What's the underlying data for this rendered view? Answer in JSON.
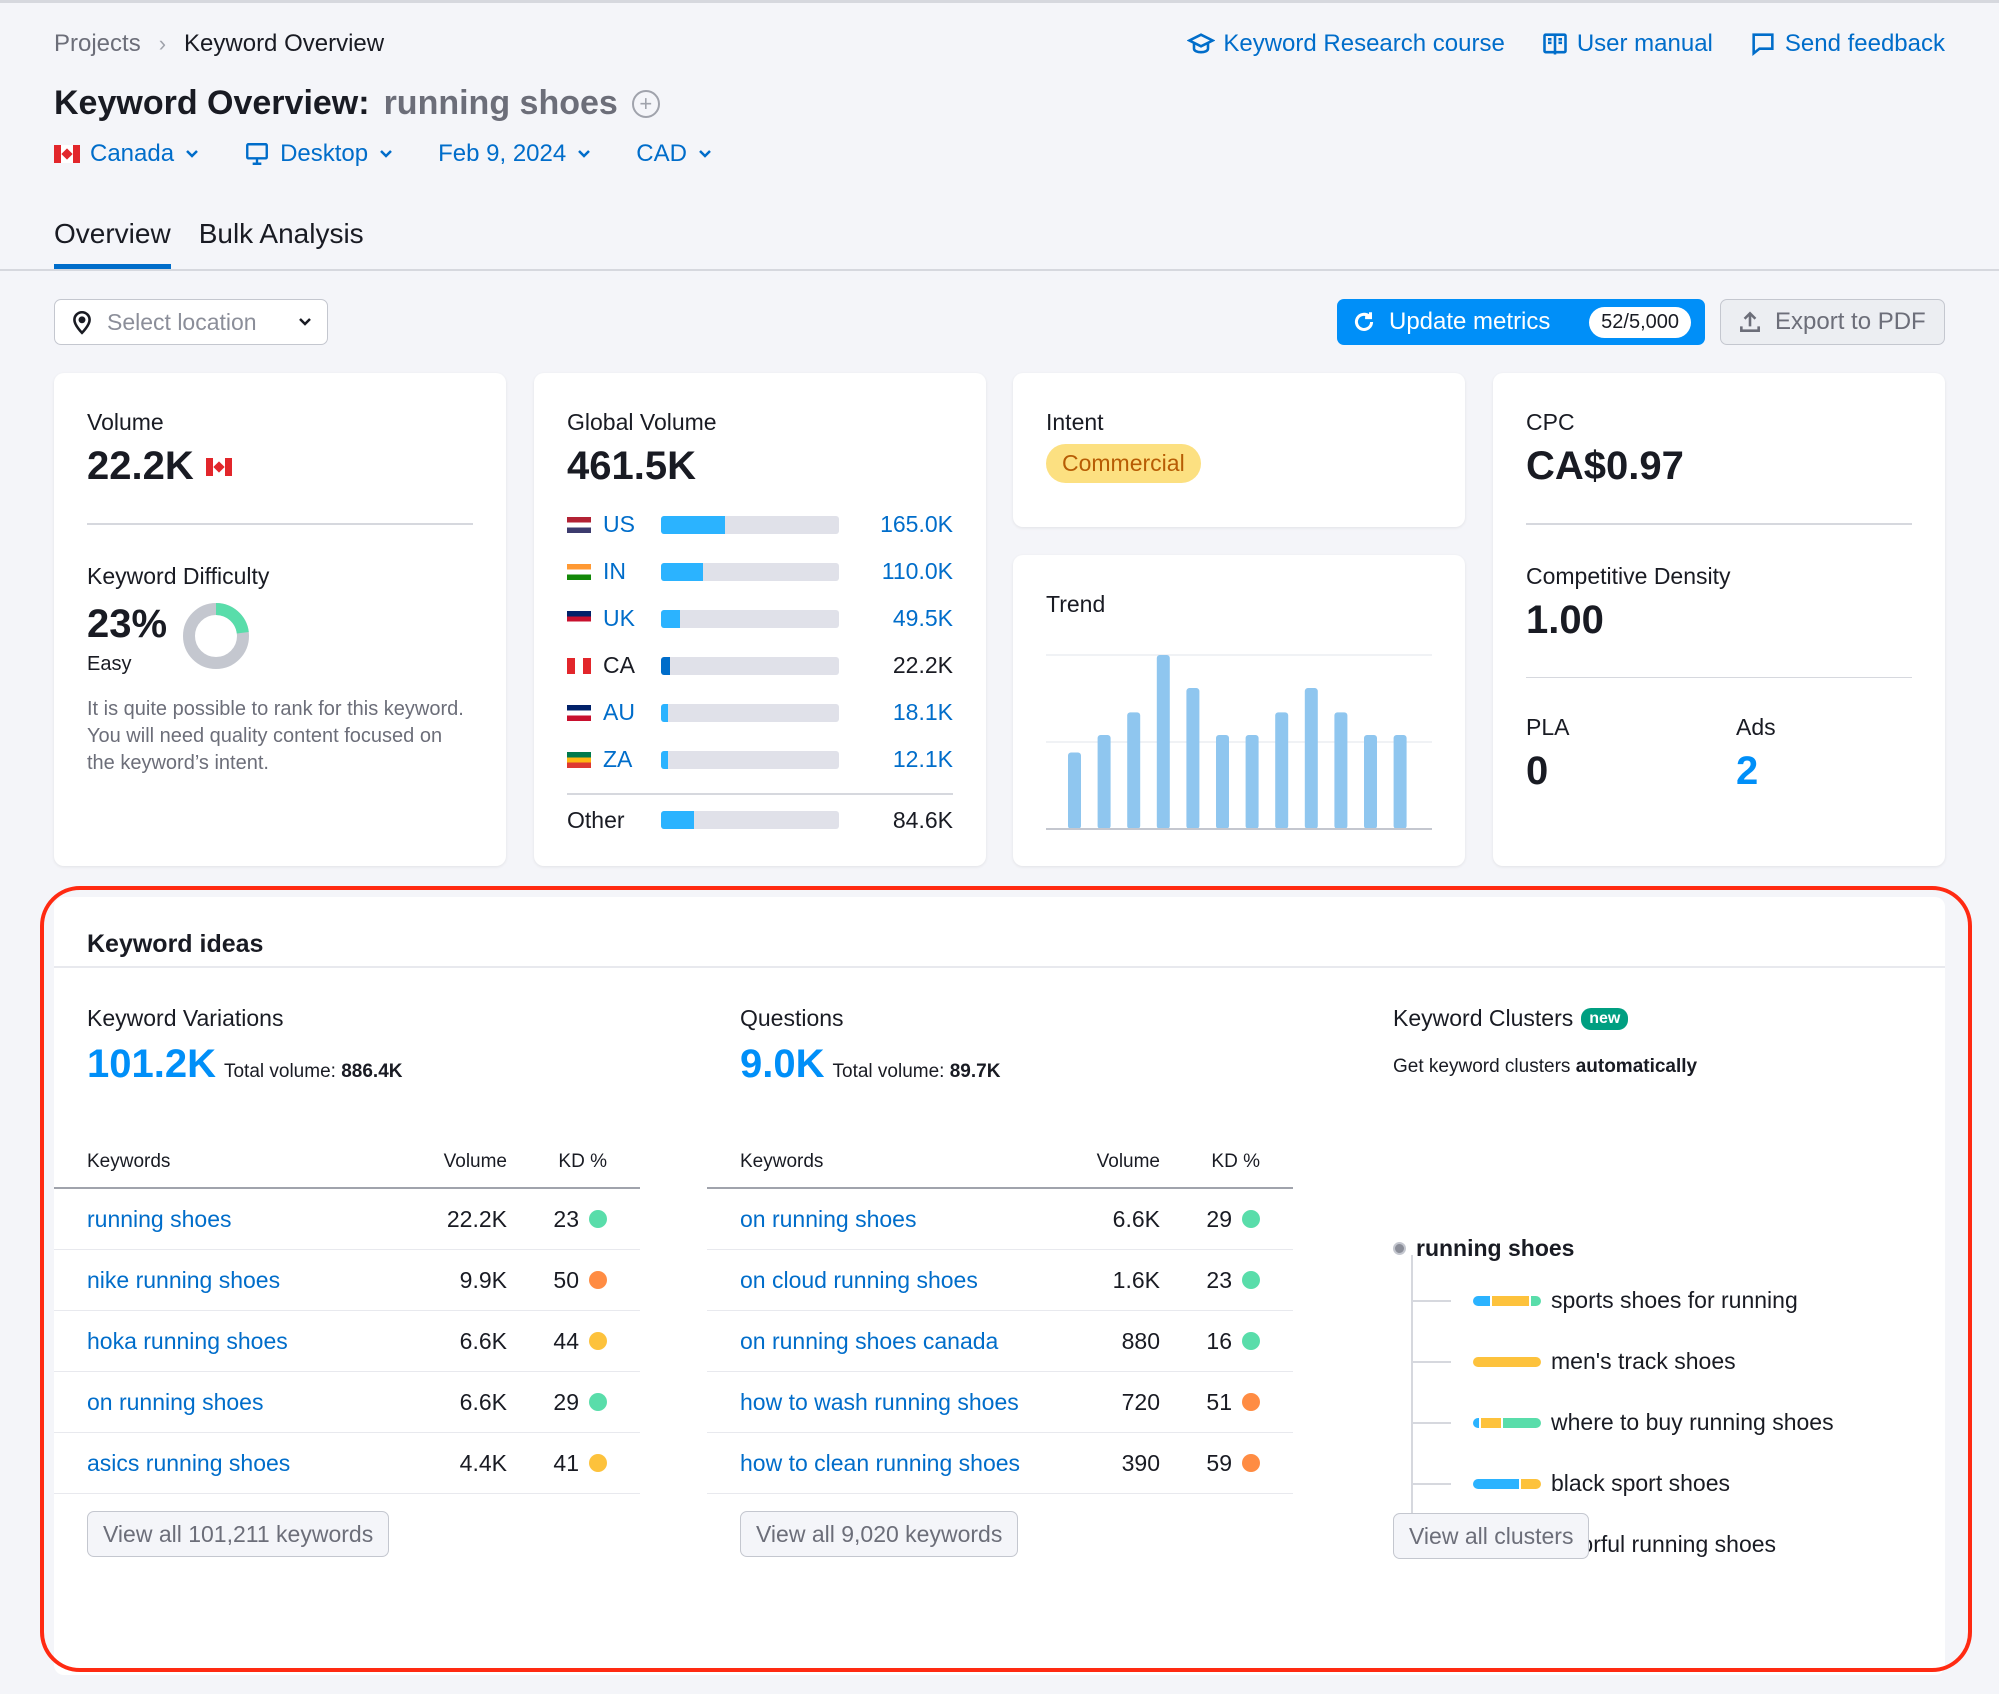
{
  "breadcrumb": [
    "Projects",
    "Keyword Overview"
  ],
  "help_links": [
    {
      "icon": "graduation-cap-icon",
      "label": "Keyword Research course"
    },
    {
      "icon": "book-icon",
      "label": "User manual"
    },
    {
      "icon": "chat-icon",
      "label": "Send feedback"
    }
  ],
  "title": {
    "prefix": "Keyword Overview:",
    "keyword": "running shoes",
    "add_icon": "+"
  },
  "filters": {
    "country": "Canada",
    "device": "Desktop",
    "date": "Feb 9, 2024",
    "currency": "CAD"
  },
  "tabs": [
    {
      "label": "Overview",
      "active": true
    },
    {
      "label": "Bulk Analysis",
      "active": false
    }
  ],
  "toolbar": {
    "location_placeholder": "Select location",
    "update_label": "Update metrics",
    "update_count": "52/5,000",
    "export_label": "Export to PDF"
  },
  "volume": {
    "label": "Volume",
    "value": "22.2K"
  },
  "difficulty": {
    "label": "Keyword Difficulty",
    "value": "23%",
    "percent": 23,
    "level": "Easy",
    "description": "It is quite possible to rank for this keyword. You will need quality content focused on the keyword’s intent.",
    "color": "#59ddaa"
  },
  "global_volume": {
    "label": "Global Volume",
    "value": "461.5K",
    "max": 165.0,
    "countries": [
      {
        "code": "US",
        "value": "165.0K",
        "num": 165.0,
        "link": true
      },
      {
        "code": "IN",
        "value": "110.0K",
        "num": 110.0,
        "link": true
      },
      {
        "code": "UK",
        "value": "49.5K",
        "num": 49.5,
        "link": true
      },
      {
        "code": "CA",
        "value": "22.2K",
        "num": 22.2,
        "link": false
      },
      {
        "code": "AU",
        "value": "18.1K",
        "num": 18.1,
        "link": true
      },
      {
        "code": "ZA",
        "value": "12.1K",
        "num": 12.1,
        "link": true
      }
    ],
    "other": {
      "label": "Other",
      "value": "84.6K",
      "num": 84.6
    }
  },
  "intent": {
    "label": "Intent",
    "value": "Commercial"
  },
  "trend": {
    "label": "Trend",
    "values": [
      0.44,
      0.54,
      0.67,
      1.0,
      0.81,
      0.54,
      0.54,
      0.67,
      0.81,
      0.67,
      0.54,
      0.54
    ]
  },
  "cpc": {
    "label": "CPC",
    "value": "CA$0.97"
  },
  "competitive_density": {
    "label": "Competitive Density",
    "value": "1.00"
  },
  "pla": {
    "label": "PLA",
    "value": "0"
  },
  "ads": {
    "label": "Ads",
    "value": "2"
  },
  "keyword_ideas": {
    "title": "Keyword ideas",
    "variations": {
      "title": "Keyword Variations",
      "count": "101.2K",
      "total_label": "Total volume:",
      "total": "886.4K",
      "headers": [
        "Keywords",
        "Volume",
        "KD %"
      ],
      "rows": [
        {
          "keyword": "running shoes",
          "volume": "22.2K",
          "kd": "23",
          "color": "#59ddaa"
        },
        {
          "keyword": "nike running shoes",
          "volume": "9.9K",
          "kd": "50",
          "color": "#ff8c43"
        },
        {
          "keyword": "hoka running shoes",
          "volume": "6.6K",
          "kd": "44",
          "color": "#fdc23c"
        },
        {
          "keyword": "on running shoes",
          "volume": "6.6K",
          "kd": "29",
          "color": "#59ddaa"
        },
        {
          "keyword": "asics running shoes",
          "volume": "4.4K",
          "kd": "41",
          "color": "#fdc23c"
        }
      ],
      "button": "View all 101,211 keywords"
    },
    "questions": {
      "title": "Questions",
      "count": "9.0K",
      "total_label": "Total volume:",
      "total": "89.7K",
      "headers": [
        "Keywords",
        "Volume",
        "KD %"
      ],
      "rows": [
        {
          "keyword": "on running shoes",
          "volume": "6.6K",
          "kd": "29",
          "color": "#59ddaa"
        },
        {
          "keyword": "on cloud running shoes",
          "volume": "1.6K",
          "kd": "23",
          "color": "#59ddaa"
        },
        {
          "keyword": "on running shoes canada",
          "volume": "880",
          "kd": "16",
          "color": "#59ddaa"
        },
        {
          "keyword": "how to wash running shoes",
          "volume": "720",
          "kd": "51",
          "color": "#ff8c43"
        },
        {
          "keyword": "how to clean running shoes",
          "volume": "390",
          "kd": "59",
          "color": "#ff8c43"
        }
      ],
      "button": "View all 9,020 keywords"
    },
    "clusters": {
      "title": "Keyword Clusters",
      "badge": "new",
      "subtitle_prefix": "Get keyword clusters",
      "subtitle_bold": "automatically",
      "root": "running shoes",
      "items": [
        {
          "label": "sports shoes for running",
          "segments": [
            {
              "color": "#2bb3ff",
              "share": 0.27
            },
            {
              "color": "#fdc23c",
              "share": 0.57
            },
            {
              "color": "#59ddaa",
              "share": 0.16
            }
          ]
        },
        {
          "label": "men's track shoes",
          "segments": [
            {
              "color": "#fdc23c",
              "share": 1.0
            }
          ]
        },
        {
          "label": "where to buy running shoes",
          "segments": [
            {
              "color": "#2bb3ff",
              "share": 0.1
            },
            {
              "color": "#fdc23c",
              "share": 0.3
            },
            {
              "color": "#59ddaa",
              "share": 0.6
            }
          ]
        },
        {
          "label": "black sport shoes",
          "segments": [
            {
              "color": "#2bb3ff",
              "share": 0.7
            },
            {
              "color": "#fdc23c",
              "share": 0.3
            }
          ]
        },
        {
          "label": "colorful running shoes",
          "segments": [
            {
              "color": "#2bb3ff",
              "share": 1.0
            }
          ]
        }
      ],
      "button": "View all clusters"
    }
  }
}
